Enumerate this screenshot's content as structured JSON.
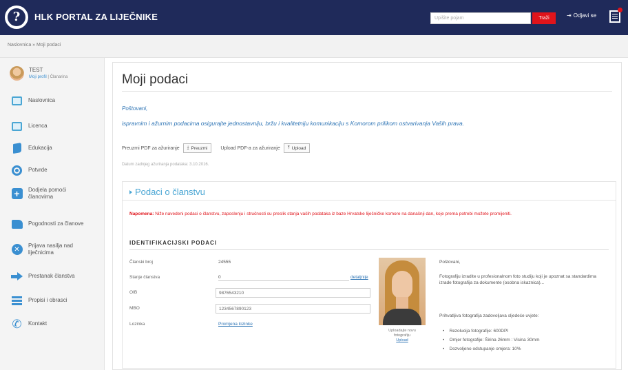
{
  "header": {
    "app_title": "HLK PORTAL ZA LIJEČNIKE",
    "search_placeholder": "Upišite pojam",
    "search_button": "Traži",
    "logout_label": "Odjavi se",
    "logo_glyph": "?"
  },
  "breadcrumb": {
    "text": "Naslovnica » Moji podaci"
  },
  "user": {
    "name": "TEST",
    "link_profile": "Moji profil",
    "sep": "|",
    "link_members": "Članarina"
  },
  "sidebar": {
    "items": [
      {
        "label": "Naslovnica",
        "icon": "monitor-icon"
      },
      {
        "label": "Licenca",
        "icon": "certificate-icon"
      },
      {
        "label": "Edukacija",
        "icon": "book-icon"
      },
      {
        "label": "Potvrde",
        "icon": "gear-icon"
      },
      {
        "label": "Dodjela pomoći",
        "label2": "članovima",
        "icon": "plus-icon"
      },
      {
        "label": "Pogodnosti za članove",
        "icon": "thumbs-up-icon"
      },
      {
        "label": "Prijava nasilja nad",
        "label2": "liječnicima",
        "icon": "close-circle-icon"
      },
      {
        "label": "Prestanak članstva",
        "icon": "exit-arrow-icon"
      },
      {
        "label": "Propisi i obrasci",
        "icon": "list-icon"
      },
      {
        "label": "Kontakt",
        "icon": "phone-icon"
      }
    ]
  },
  "main": {
    "title": "Moji podaci",
    "greeting": "Poštovani,",
    "intro": "ispravnim i ažurnim podacima osigurajte jednostavniju, bržu i kvalitetniju komunikaciju s Komorom prilikom ostvarivanja Vaših prava.",
    "pdf_download_label": "Preuzmi PDF za ažuriranje",
    "pdf_download_button": "Preuzmi",
    "pdf_upload_label": "Upload PDF-a za ažuriranje",
    "pdf_upload_button": "Upload",
    "date_note": "Datum zadnjeg ažuriranja podataka: 3.10.2016."
  },
  "panel": {
    "title": "Podaci o članstvu",
    "warning_bold": "Napomena:",
    "warning_text": "Niže navedeni podaci o članstvu, zaposlenju i stručnosti su preslik stanja vaših podataka iz baze Hrvatske liječničke komore na današnji dan, koje prema potrebi možete promijeniti.",
    "section_title": "IDENTIFIKACIJSKI PODACI",
    "fields": {
      "member_no_label": "Članski broj",
      "member_no_value": "24555",
      "status_label": "Stanje članstva",
      "status_value": "0",
      "status_link": "detaljnije",
      "oib_label": "OIB",
      "oib_value": "98765432​10",
      "mbo_label": "MBO",
      "mbo_value": "123456789012​3",
      "password_label": "Lozinka",
      "password_link": "Promjena lozinke"
    },
    "photo_caption_1": "Uploadajte novu",
    "photo_caption_2": "fotografiju",
    "photo_upload_link": "Upload",
    "photo_greeting": "Poštovani,",
    "photo_text": "Fotografiju izradite u profesionalnom foto studiju koji je upoznat sa standardima izrade fotografija za dokumente (osobna iskaznica)...",
    "photo_requirements_intro": "Prihvatljiva fotografija zadovoljava sljedeće uvjete:",
    "requirements": [
      "Rezolucija fotografije: 600DPI",
      "Omjer fotografije: Širina 26mm : Visina 30mm",
      "Dozvoljeno odstupanje omjera: 10%"
    ]
  }
}
